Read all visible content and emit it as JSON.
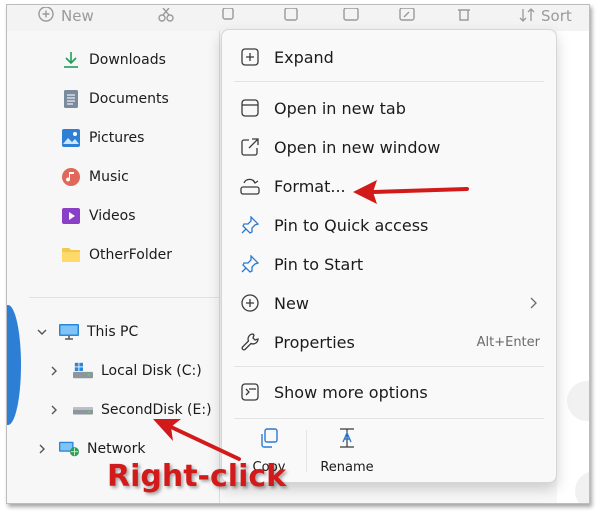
{
  "toolbar": {
    "new_label": "New",
    "sort_label": "Sort"
  },
  "nav": {
    "quick_items": [
      {
        "label": "Downloads",
        "icon": "download-icon"
      },
      {
        "label": "Documents",
        "icon": "documents-icon"
      },
      {
        "label": "Pictures",
        "icon": "pictures-icon"
      },
      {
        "label": "Music",
        "icon": "music-icon"
      },
      {
        "label": "Videos",
        "icon": "videos-icon"
      },
      {
        "label": "OtherFolder",
        "icon": "folder-icon"
      }
    ],
    "this_pc": "This PC",
    "local_disk": "Local Disk (C:)",
    "second_disk": "SecondDisk (E:)",
    "network": "Network"
  },
  "context_menu": {
    "expand": "Expand",
    "open_new_tab": "Open in new tab",
    "open_new_window": "Open in new window",
    "format": "Format...",
    "pin_quick_access": "Pin to Quick access",
    "pin_start": "Pin to Start",
    "new": "New",
    "properties": "Properties",
    "properties_shortcut": "Alt+Enter",
    "show_more": "Show more options",
    "copy": "Copy",
    "rename": "Rename"
  },
  "annotation": {
    "text": "Right-click",
    "color": "#d21a1a"
  },
  "colors": {
    "accent": "#0067c0",
    "folder": "#f2c94c"
  }
}
